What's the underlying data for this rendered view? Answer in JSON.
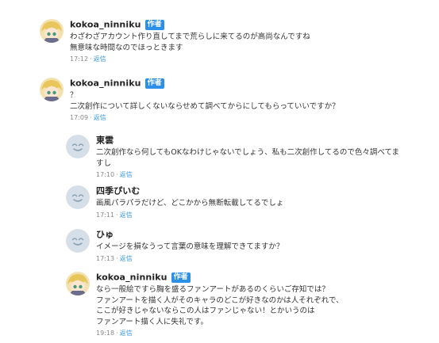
{
  "author_badge": "作者",
  "separator": "·",
  "colors": {
    "badge": "#2c8fe8",
    "reply_link": "#3a97e0",
    "meta": "#888888",
    "default_avatar": "#d6dfe7"
  },
  "comments": [
    {
      "username": "kokoa_ninniku",
      "is_author": true,
      "avatar": "character-avatar",
      "lines": [
        "わざわざアカウント作り直してまで荒らしに来てるのが高尚なんですね",
        "無意味な時間なのでほっときます"
      ],
      "time": "17:12",
      "reply_label": "返信"
    },
    {
      "username": "kokoa_ninniku",
      "is_author": true,
      "avatar": "character-avatar",
      "lines": [
        "？",
        "二次創作について詳しくないならせめて調べてからにしてもらっていいですか？"
      ],
      "time": "17:09",
      "reply_label": "返信"
    },
    {
      "username": "東雲",
      "is_author": false,
      "avatar": "default-face-avatar",
      "lines": [
        "二次創作なら何してもOKなわけじゃないでしょう、私も二次創作してるので色々調べてま",
        "すし"
      ],
      "time": "17:10",
      "reply_label": "返信"
    },
    {
      "username": "四季ぴいむ",
      "is_author": false,
      "avatar": "default-face-avatar",
      "lines": [
        "画風パラパラだけど、どこかから無断転載してるでしょ"
      ],
      "time": "17:11",
      "reply_label": "返信"
    },
    {
      "username": "ひゅ",
      "is_author": false,
      "avatar": "default-face-avatar",
      "lines": [
        "イメージを損なうって言葉の意味を理解できてますか？"
      ],
      "time": "17:13",
      "reply_label": "返信"
    },
    {
      "username": "kokoa_ninniku",
      "is_author": true,
      "avatar": "character-avatar",
      "lines": [
        "なら一般絵ですら胸を盛るファンアートがあるのくらいご存知では？",
        "ファンアートを描く人がそのキャラのどこが好きなのかは人それぞれで、",
        "ここが好きじゃないならこの人はファンじゃない！とかいうのは",
        "ファンアート描く人に失礼です。"
      ],
      "time": "19:18",
      "reply_label": "返信"
    }
  ]
}
